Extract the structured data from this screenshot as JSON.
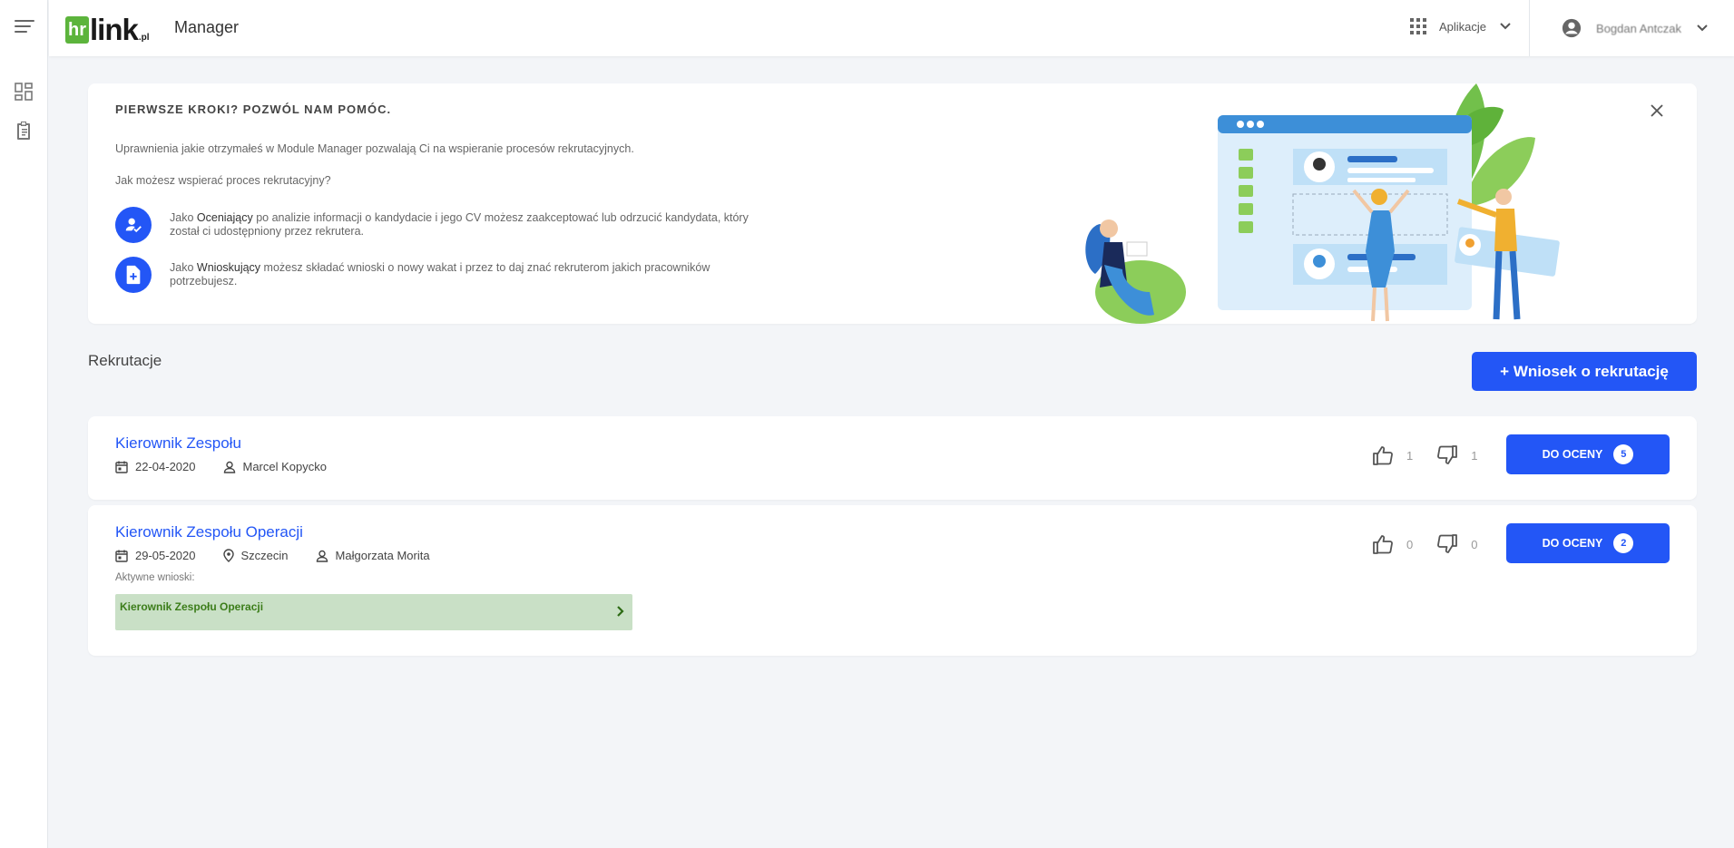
{
  "logo": {
    "hr": "hr",
    "link": "link",
    "pl": ".pl"
  },
  "header": {
    "app_name": "Manager",
    "apps_label": "Aplikacje",
    "user_name": "Bogdan Antczak"
  },
  "welcome": {
    "title": "PIERWSZE KROKI? POZWÓL NAM POMÓC.",
    "paragraph1": "Uprawnienia jakie otrzymałeś w Module Manager pozwalają Ci na wspieranie procesów rekrutacyjnych.",
    "paragraph2": "Jak możesz wspierać proces rekrutacyjny?",
    "role1_prefix": "Jako ",
    "role1_name": "Oceniający",
    "role1_text": " po analizie informacji o kandydacie i jego CV możesz zaakceptować lub odrzucić kandydata, który został ci udostępniony przez rekrutera.",
    "role2_prefix": "Jako ",
    "role2_name": "Wnioskujący",
    "role2_text": " możesz składać wnioski o nowy wakat i przez to daj znać rekruterom jakich pracowników potrzebujesz."
  },
  "recruitments": {
    "section_title": "Rekrutacje",
    "new_button": "+ Wniosek o rekrutację",
    "items": [
      {
        "title": "Kierownik Zespołu",
        "date": "22-04-2020",
        "person": "Marcel Kopycko",
        "likes": "1",
        "dislikes": "1",
        "rate_label": "DO OCENY",
        "rate_count": "5"
      },
      {
        "title": "Kierownik Zespołu Operacji",
        "date": "29-05-2020",
        "location": "Szczecin",
        "person": "Małgorzata Morita",
        "likes": "0",
        "dislikes": "0",
        "rate_label": "DO OCENY",
        "rate_count": "2",
        "active_label": "Aktywne wnioski:",
        "active_request": "Kierownik Zespołu Operacji"
      }
    ]
  },
  "colors": {
    "primary": "#2356f6",
    "brand_green": "#5cb43c",
    "active_bg": "#c9e0c6",
    "active_text": "#3c7d1a"
  }
}
